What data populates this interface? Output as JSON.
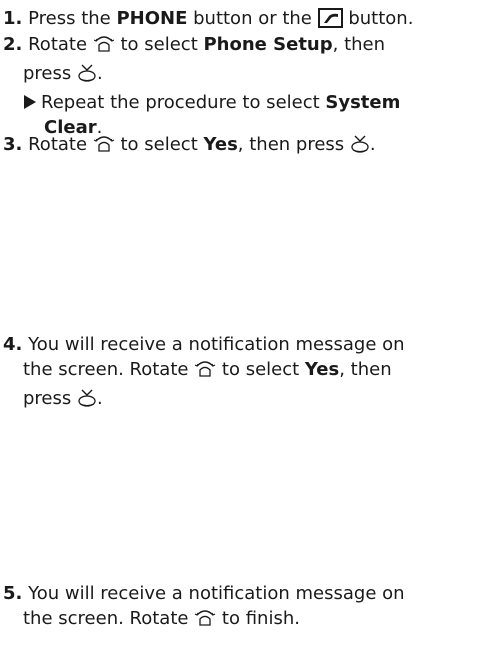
{
  "steps": [
    {
      "num": "1.",
      "a": "Press the ",
      "b_phone": "PHONE",
      "c": " button or the ",
      "d": " button."
    },
    {
      "num": "2.",
      "a": "Rotate ",
      "b": " to select ",
      "b_bold": "Phone Setup",
      "c": ", then",
      "line2": "press ",
      "line2_end": ".",
      "sub_a": "Repeat the procedure to select ",
      "sub_bold1": "System",
      "sub_bold2": "Clear",
      "sub_end": "."
    },
    {
      "num": "3.",
      "a": "Rotate ",
      "b": " to select ",
      "b_bold": "Yes",
      "c": ", then press ",
      "d": "."
    },
    {
      "num": "4.",
      "a": "You will receive a notification message on",
      "line2a": "the screen. Rotate ",
      "line2b": " to select ",
      "line2_bold": "Yes",
      "line2c": ", then",
      "line3": "press ",
      "line3_end": "."
    },
    {
      "num": "5.",
      "a": "You will receive a notification message on",
      "line2a": "the screen. Rotate ",
      "line2b": " to finish."
    }
  ],
  "icons": {
    "knob": "interface-dial-icon",
    "enter": "enter-press-icon",
    "phone": "phone-button-icon"
  }
}
